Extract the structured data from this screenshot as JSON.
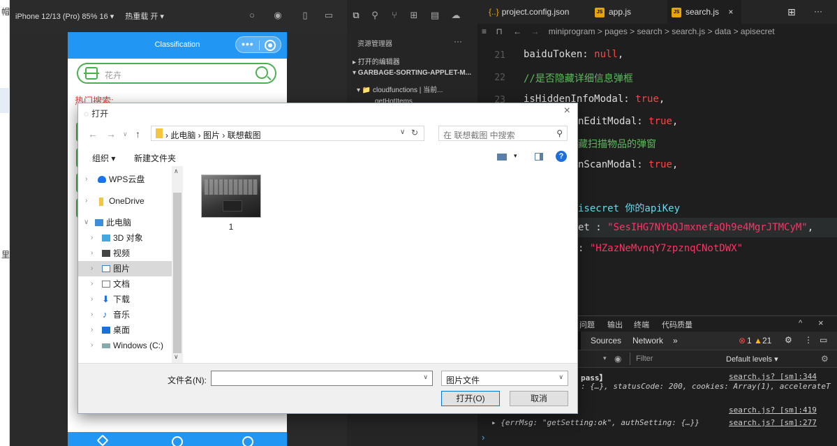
{
  "left_strip": {
    "top_text": "帽",
    "mid_text": "里"
  },
  "simulator": {
    "device": "iPhone 12/13 (Pro) 85% 16 ▾",
    "hot_reload": "热重载 开 ▾",
    "nav_title": "Classification",
    "search_placeholder": "花卉",
    "hot_search_label": "热门搜索:"
  },
  "explorer": {
    "title": "资源管理器",
    "more": "···",
    "open_editors": "▸ 打开的编辑器",
    "project": "▾ GARBAGE-SORTING-APPLET-M...",
    "cloudfunctions": "▾ 📁 cloudfunctions | 当前...",
    "sub_item": "getHotItems"
  },
  "editor": {
    "tabs": [
      "project.config.json",
      "app.js",
      "search.js"
    ],
    "tab_close": "×",
    "breadcrumb": "miniprogram > pages > search > search.js > data > apisecret",
    "line_numbers": [
      "21",
      "22",
      "23",
      "24",
      "25",
      "26",
      "27",
      "28",
      "29",
      "30",
      "31",
      "32",
      "33"
    ],
    "lines": {
      "l21_key": "baiduToken: ",
      "l21_val": "null",
      "l21_end": ",",
      "l22": "//是否隐藏详细信息弹框",
      "l23_key": "isHiddenInfoModal: ",
      "l23_val": "true",
      "l23_end": ",",
      "l24_key": "nEditModal: ",
      "l24_val": "true",
      "l24_end": ",",
      "l25": "藏扫描物品的弹窗",
      "l26_key": "nScanModal: ",
      "l26_val": "true",
      "l26_end": ",",
      "l28": "isecret 你的apiKey",
      "l29_key": "et : ",
      "l29_val": "\"SesIHG7NYbQJmxnefaQh9e4MgrJTMCyM\"",
      "l29_end": ",",
      "l30_key": ": ",
      "l30_val": "\"HZazNeMvnqY7zpznqCNotDWX\""
    }
  },
  "panel": {
    "tabs": [
      "问题",
      "输出",
      "终端",
      "代码质量"
    ],
    "devtools_tabs": [
      "Sources",
      "Network",
      "»"
    ],
    "errors": "1",
    "warnings": "21",
    "filter_placeholder": "Filter",
    "levels": "Default levels ▾",
    "logs": [
      {
        "text": "pass】",
        "link": "search.js? [sm]:344"
      },
      {
        "text": ": {…}, statusCode: 200, cookies: Array(1), accelerateT",
        "link": ""
      },
      {
        "text": "",
        "link": "search.js? [sm]:419"
      },
      {
        "text": "▸ {errMsg: \"getSetting:ok\", authSetting: {…}}",
        "link": "search.js? [sm]:277"
      }
    ],
    "prompt": "›"
  },
  "dialog": {
    "title": "打开",
    "close": "×",
    "address": "› 此电脑 › 图片 › 联想截图",
    "search_placeholder": "在 联想截图 中搜索",
    "organize": "组织 ▾",
    "new_folder": "新建文件夹",
    "tree": [
      "WPS云盘",
      "OneDrive",
      "此电脑",
      "3D 对象",
      "视频",
      "图片",
      "文档",
      "下载",
      "音乐",
      "桌面",
      "Windows (C:)"
    ],
    "file_name": "1",
    "filename_label": "文件名(N):",
    "filetype": "图片文件",
    "open_btn": "打开(O)",
    "cancel_btn": "取消"
  }
}
